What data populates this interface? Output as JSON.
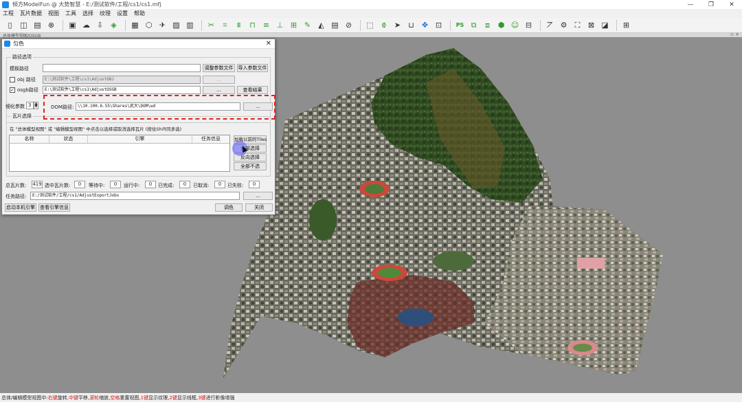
{
  "window": {
    "title": "倾方ModelFun @ 大势智慧 - E:/测试软件/工程/cs1/cs1.mfj",
    "controls": [
      "—",
      "❐",
      "✕"
    ]
  },
  "menu": [
    "工程",
    "瓦片数据",
    "视图",
    "工具",
    "选择",
    "纹理",
    "设置",
    "帮助"
  ],
  "toolbar": {
    "ps_label": "PS",
    "icons": [
      "new-file-icon",
      "split-icon",
      "save-icon",
      "close-circle-icon",
      "stop-icon",
      "cloud-icon",
      "import-icon",
      "layers-icon",
      "grid-icon",
      "cube-icon",
      "plane-icon",
      "image-icon",
      "building-icon",
      "cut-icon",
      "crop-icon",
      "flatten-icon",
      "bridge-icon",
      "road-icon",
      "lamp-icon",
      "wall-icon",
      "magic-icon",
      "fill-icon",
      "texture-icon",
      "erase-icon",
      "select-rect-icon",
      "select-lasso-icon",
      "pointer-icon",
      "basket-icon",
      "move-icon",
      "fit-icon",
      "photoshop-icon",
      "copy-icon",
      "clone-icon",
      "model-icon",
      "person-icon",
      "chart-icon",
      "gear-icon",
      "mesh-icon",
      "export-icon",
      "texture-flag-icon",
      "settings-icon"
    ]
  },
  "viewport": {
    "title": "总体模型视图/OSGB",
    "controls": "▫ ×"
  },
  "dialog": {
    "title": "匀色",
    "close": "✕",
    "path_group": "路径选项",
    "template_path_label": "模板路径",
    "template_path_value": "",
    "adjust_params_button": "调整参数文件",
    "import_params_button": "导入参数文件",
    "obj_checkbox_label": "obj 路径",
    "obj_checked": false,
    "obj_path_value": "E:\\测试软件\\工程\\cs1\\AdjustOBJ",
    "obj_browse": "...",
    "osgb_checkbox_label": "osgb路径",
    "osgb_checked": true,
    "osgb_path_value": "E:\\测试软件\\工程\\cs1\\AdjustOSGB",
    "osgb_browse": "...",
    "view_result_button": "查看结果",
    "refine_label": "细化参数",
    "refine_value": "3",
    "dom_label": "DOM路径:",
    "dom_path_value": "\\\\10.100.6.55\\Shares\\武大\\DOM\\wd",
    "dom_browse": "...",
    "tile_group": "瓦片选择",
    "tile_hint": "在 \"总体模型视图\" 或 \"编辑模型视图\" 中点击以选择或取消选择瓦片 (按住Shift同多选)",
    "table_headers": [
      "名称",
      "状态",
      "引擎",
      "任务信息"
    ],
    "load_tiles_button": "加载以前的Tiles",
    "select_all_button": "全部选择",
    "invert_select_button": "反向选择",
    "deselect_all_button": "全部不选",
    "total_tiles_label": "总瓦片数:",
    "total_tiles_value": "419",
    "selected_label": "选中瓦片数:",
    "selected_value": "0",
    "waiting_label": "等待中:",
    "waiting_value": "0",
    "running_label": "运行中:",
    "running_value": "0",
    "done_label": "已完成:",
    "done_value": "0",
    "cancelled_label": "已取消:",
    "cancelled_value": "0",
    "failed_label": "已失败:",
    "failed_value": "0",
    "task_path_label": "任务路径:",
    "task_path_value": "E:/测试软件/工程/cs1/AdjustExportJobs",
    "task_browse": "...",
    "start_engine_button": "启动本机引擎",
    "view_engine_button": "查看引擎信息",
    "color_button": "调色",
    "close_button": "关闭"
  },
  "status": {
    "prefix": "总体/编辑模型视图中:",
    "k1": "右键",
    "t1": "旋转,",
    "k2": "中键",
    "t2": "平移,",
    "k3": "滚轮",
    "t3": "缩放,",
    "k4": "空格",
    "t4": "重置视图,",
    "k5": "1键",
    "t5": "显示纹理,",
    "k6": "2键",
    "t6": "显示线框,",
    "k7": "3键",
    "t7": "进行影像增强"
  },
  "colors": {
    "viewport_bg": "#8e8e8e",
    "dashed_highlight": "#e02222",
    "status_key": "#d01010"
  }
}
